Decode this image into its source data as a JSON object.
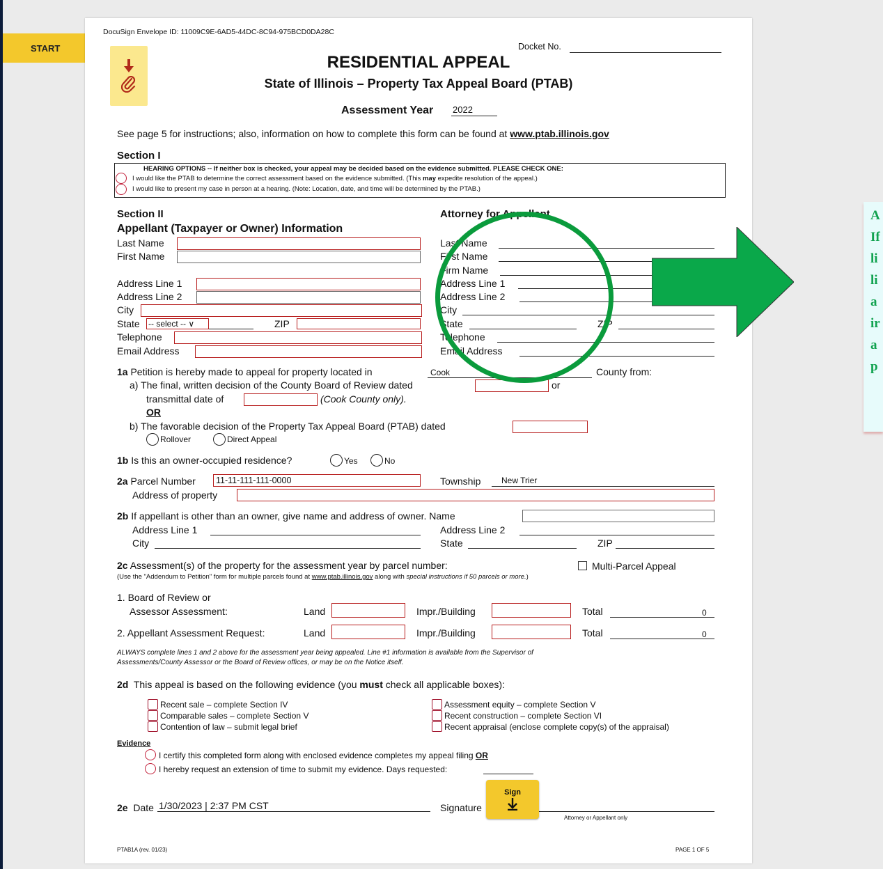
{
  "start_label": "START",
  "envelope_id": "DocuSign Envelope ID: 11009C9E-6AD5-44DC-8C94-975BCD0DA28C",
  "docket_label": "Docket No.",
  "title": "RESIDENTIAL APPEAL",
  "subtitle": "State of Illinois – Property Tax Appeal Board (PTAB)",
  "assessment_year_label": "Assessment Year",
  "assessment_year_value": "2022",
  "instructions_prefix": "See page 5 for instructions; also, information on how to complete this form can be found at",
  "instructions_link": "www.ptab.illinois.gov",
  "section1": {
    "heading": "Section I",
    "hearing_text": "HEARING OPTIONS -- If neither box is checked, your appeal may be decided based on the evidence submitted.  PLEASE CHECK ONE:",
    "option1_a": "I would like the PTAB to determine the correct assessment based on the evidence submitted. (This",
    "option1_b": "may",
    "option1_c": "expedite resolution of the appeal.)",
    "option2": "I would like to present my case in person at a hearing. (Note: Location, date, and time will be determined by the PTAB.)"
  },
  "section2": {
    "heading": "Section II",
    "appellant_heading": "Appellant (Taxpayer or Owner) Information",
    "attorney_heading": "Attorney for Appellant",
    "last_name": "Last Name",
    "first_name": "First Name",
    "firm_name": "Firm Name",
    "address1": "Address Line 1",
    "address2": "Address Line 2",
    "city": "City",
    "state": "State",
    "state_select": "-- select -- ∨",
    "zip": "ZIP",
    "telephone": "Telephone",
    "email": "Email Address"
  },
  "q1a": {
    "text": "Petition is hereby made to appeal for property located in",
    "label": "1a",
    "county_value": "Cook",
    "county_suffix": "County from:",
    "a_text": "a)  The final, written decision of the County Board of Review dated",
    "a_or": "or",
    "a_trans": "transmittal date of",
    "a_cook": "(Cook County only).",
    "or": "OR",
    "b_text": "b)  The favorable decision of the Property Tax Appeal Board (PTAB) dated",
    "rollover": "Rollover",
    "direct": "Direct Appeal"
  },
  "q1b": {
    "label": "1b",
    "text": "Is this an owner-occupied residence?",
    "yes": "Yes",
    "no": "No"
  },
  "q2a": {
    "label": "2a",
    "parcel_label": "Parcel Number",
    "parcel_value": "11-11-111-111-0000",
    "township_label": "Township",
    "township_value": "New Trier",
    "address_label": "Address of property"
  },
  "q2b": {
    "label": "2b",
    "text": "If appellant is other than an owner, give name and address of owner. Name",
    "address1": "Address Line 1",
    "address2": "Address Line 2",
    "city": "City",
    "state": "State",
    "zip": "ZIP"
  },
  "q2c": {
    "label": "2c",
    "text": "Assessment(s) of the property for the assessment year by parcel number:",
    "multi": "Multi-Parcel Appeal",
    "note_a": "(Use the \"Addendum to Petition\" form for multiple parcels found at",
    "note_link": "www.ptab.illinois.gov",
    "note_b": "along with",
    "note_c": "special instructions if 50 parcels or more.",
    "note_d": ")",
    "row1_a": "1. Board of Review or",
    "row1_b": "Assessor Assessment:",
    "row2": "2. Appellant Assessment Request:",
    "land": "Land",
    "impr": "Impr./Building",
    "total": "Total",
    "total1": "0",
    "total2": "0",
    "always_1": "ALWAYS complete lines 1 and 2 above for the assessment year being appealed. Line #1 information is available from the Supervisor of",
    "always_2": "Assessments/County Assessor or the Board of Review offices, or may be on the Notice itself."
  },
  "q2d": {
    "label": "2d",
    "text_a": "This appeal is based on the following evidence (you",
    "text_must": "must",
    "text_b": "check all applicable boxes):",
    "c1": "Recent sale – complete Section IV",
    "c2": "Comparable sales – complete Section V",
    "c3": "Contention of law – submit legal brief",
    "c4": "Assessment equity – complete Section V",
    "c5": "Recent construction – complete Section VI",
    "c6": "Recent appraisal  (enclose complete copy(s) of the appraisal)",
    "evidence": "Evidence",
    "ev1": "I certify this completed form along with enclosed evidence completes my appeal filing",
    "ev1_or": "OR",
    "ev2": "I hereby request an extension of time to submit my evidence. Days requested:"
  },
  "q2e": {
    "label": "2e",
    "date_label": "Date",
    "date_value": "1/30/2023 | 2:37 PM CST",
    "signature_label": "Signature",
    "sign_button": "Sign",
    "attorney_note": "Attorney or Appellant only"
  },
  "footer_left": "PTAB1A (rev. 01/23)",
  "footer_right": "PAGE 1 OF 5",
  "callout_text": [
    "A",
    "If",
    "li",
    "li",
    "a",
    "ir",
    "a",
    "p"
  ],
  "colors": {
    "highlight": "#0a9b3c",
    "tab": "#f3c82c",
    "field_border": "#b71c1c"
  }
}
